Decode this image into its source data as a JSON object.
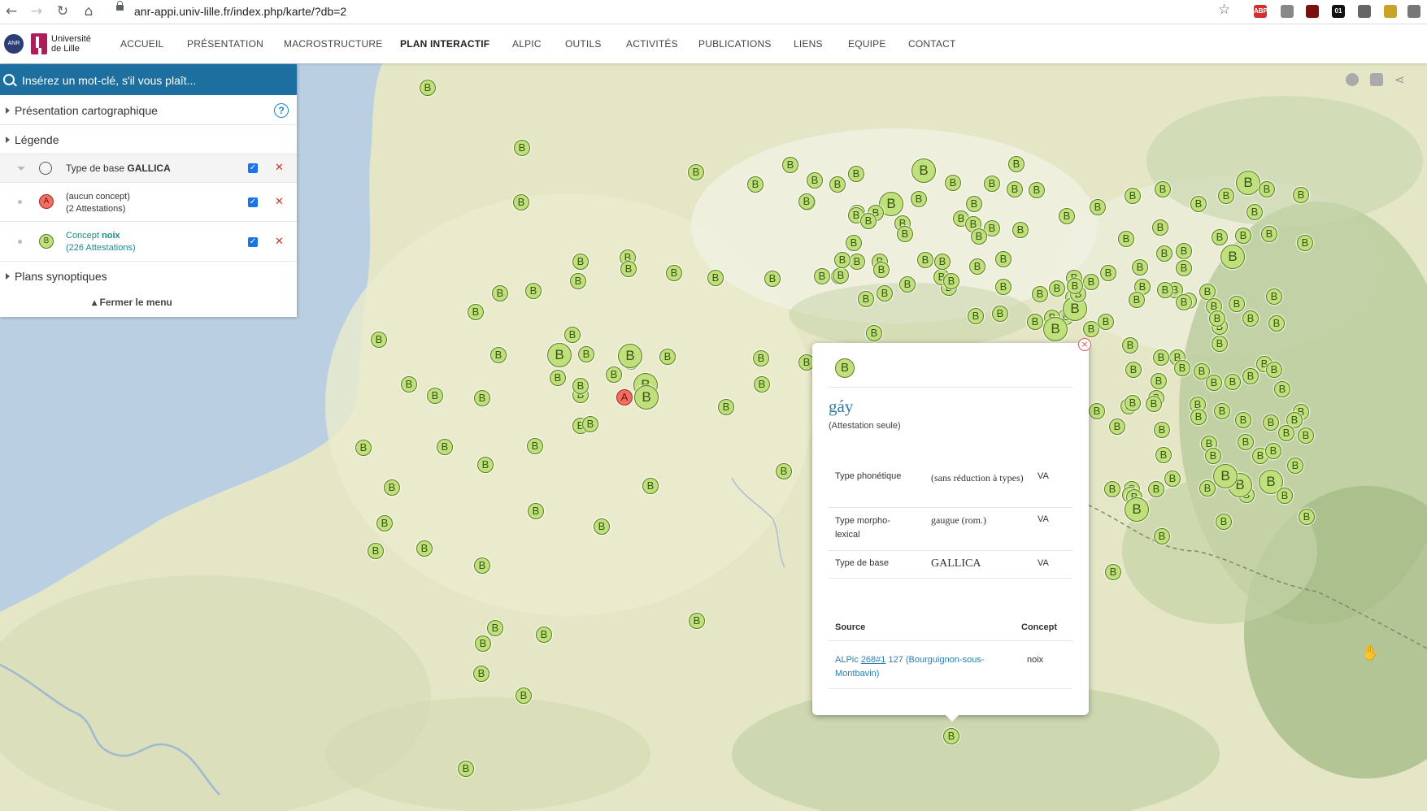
{
  "browser": {
    "url": "anr-appi.univ-lille.fr/index.php/karte/?db=2",
    "extensions": [
      "ABP",
      "01"
    ]
  },
  "header": {
    "logo_text_line1": "Université",
    "logo_text_line2": "de Lille",
    "anr_text": "ANR",
    "menu": [
      {
        "label": "ACCUEIL"
      },
      {
        "label": "PRÉSENTATION"
      },
      {
        "label": "MACROSTRUCTURE"
      },
      {
        "label": "PLAN INTERACTIF",
        "active": true
      },
      {
        "label": "ALPIC"
      },
      {
        "label": "OUTILS"
      },
      {
        "label": "ACTIVITÉS"
      },
      {
        "label": "PUBLICATIONS"
      },
      {
        "label": "LIENS"
      },
      {
        "label": "EQUIPE"
      },
      {
        "label": "CONTACT"
      }
    ]
  },
  "sidebar": {
    "search_placeholder": "Insérez un mot-clé, s'il vous plaît...",
    "section_presentation": "Présentation cartographique",
    "section_legende": "Légende",
    "legend_type_label": "Type de base",
    "legend_type_value": "GALLICA",
    "legend_items": [
      {
        "symbol": "A",
        "line1": "(aucun concept)",
        "line2": "(2 Attestations)"
      },
      {
        "symbol": "B",
        "line1_prefix": "Concept",
        "line1_value": "noix",
        "line2": "(226 Attestations)"
      }
    ],
    "section_plans": "Plans synoptiques",
    "close_menu": "Fermer le menu"
  },
  "popup": {
    "symbol": "B",
    "word": "gáy",
    "attestation": "(Attestation seule)",
    "rows": [
      {
        "label": "Type phonétique",
        "value": "(sans réduction à types)",
        "tag": "VA"
      },
      {
        "label": "Type morpho-lexical",
        "value": "gaugue (rom.)",
        "tag": "VA"
      },
      {
        "label": "Type de base",
        "value": "GALLICA",
        "tag": "VA"
      }
    ],
    "source_header": "Source",
    "concept_header": "Concept",
    "source_prefix": "ALPic",
    "source_link": "268#1",
    "source_rest": "127 (Bourguignon-sous-Montbavin)",
    "concept_value": "noix"
  },
  "map": {
    "marker_letter_b": "B",
    "marker_letter_a": "A",
    "colors": {
      "green": "#bfe07c",
      "red": "#ef6f63",
      "sea": "#b9cfe0",
      "land": "#e4e6c6"
    }
  }
}
